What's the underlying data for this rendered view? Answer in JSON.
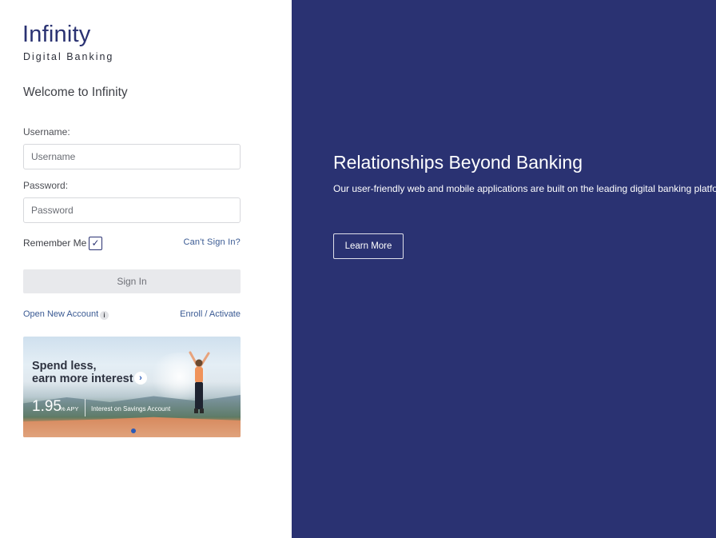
{
  "brand": {
    "name": "Infinity",
    "tagline": "Digital Banking"
  },
  "login": {
    "welcome": "Welcome to Infinity",
    "username_label": "Username:",
    "username_placeholder": "Username",
    "username_value": "",
    "password_label": "Password:",
    "password_placeholder": "Password",
    "password_value": "",
    "remember_label": "Remember Me",
    "remember_checked": true,
    "remember_glyph": "✓",
    "cant_sign_in": "Can't Sign In?",
    "sign_in_button": "Sign In",
    "open_account": "Open New Account",
    "info_glyph": "i",
    "enroll": "Enroll / Activate"
  },
  "promo": {
    "headline_line1": "Spend less,",
    "headline_line2": "earn more interest",
    "arrow_glyph": "›",
    "rate": "1.95",
    "rate_suffix": "% APY",
    "description": "Interest on Savings Account",
    "carousel_pages": 1
  },
  "hero": {
    "title": "Relationships Beyond Banking",
    "subtitle": "Our user-friendly web and mobile applications are built on the leading digital banking platform.",
    "button": "Learn More"
  },
  "colors": {
    "brand_navy": "#2a3272",
    "link_blue": "#3a5a93",
    "button_disabled_bg": "#e8e9ec"
  },
  "icons": {
    "info": "info-icon",
    "checkbox": "checkmark-icon",
    "promo_arrow": "chevron-right-icon"
  }
}
